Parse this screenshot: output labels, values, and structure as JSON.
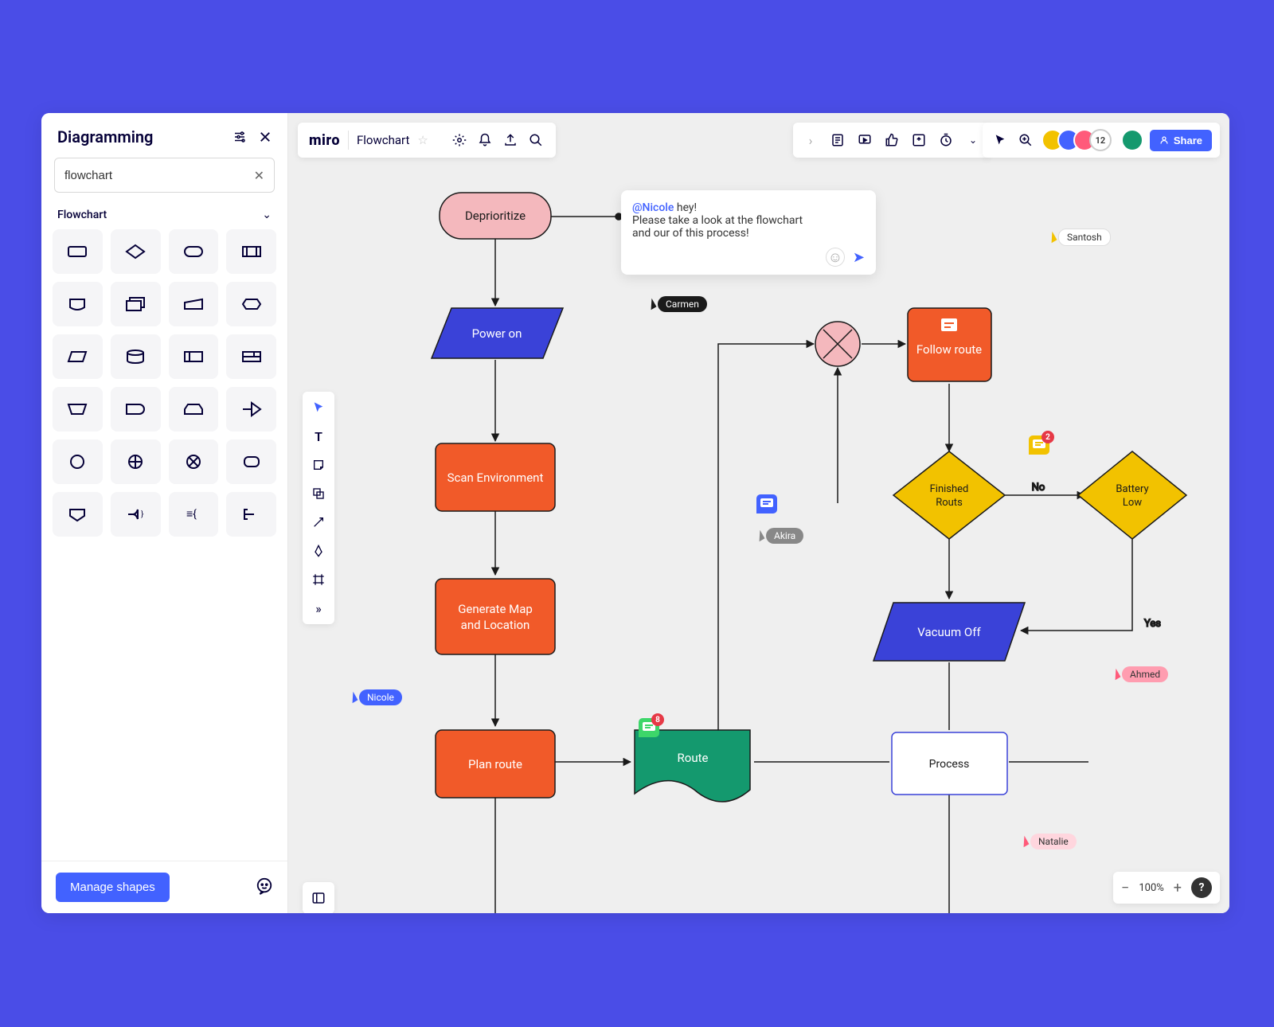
{
  "panel": {
    "title": "Diagramming",
    "search_value": "flowchart",
    "section_label": "Flowchart",
    "manage_label": "Manage shapes",
    "shapes": [
      "rectangle",
      "diamond",
      "rounded-rect",
      "predefined-process",
      "display",
      "multi-document",
      "manual-input",
      "preparation",
      "parallelogram",
      "database",
      "internal-storage",
      "card",
      "manual-operation",
      "delay",
      "loop-limit",
      "off-page",
      "circle",
      "summing-junction",
      "or-junction",
      "collate",
      "data-storage",
      "merge-right",
      "merge-left",
      "annotation"
    ]
  },
  "header": {
    "brand": "miro",
    "board_name": "Flowchart",
    "share_label": "Share",
    "avatar_count": "12"
  },
  "zoom": {
    "level": "100%"
  },
  "comment": {
    "mention": "@Nicole",
    "greeting": " hey!",
    "line2": "Please take a look at the flowchart",
    "line3": "and our of this process!"
  },
  "nodes": {
    "deprioritize": "Deprioritize",
    "power_on": "Power on",
    "scan_env": "Scan Environment",
    "gen_map1": "Generate Map",
    "gen_map2": "and Location",
    "plan_route": "Plan route",
    "route": "Route",
    "process": "Process",
    "follow_route": "Follow route",
    "finished1": "Finished",
    "finished2": "Routs",
    "battery1": "Battery",
    "battery2": "Low",
    "vacuum_off": "Vacuum Off"
  },
  "edges": {
    "no": "No",
    "yes": "Yes"
  },
  "cursors": {
    "nicole": "Nicole",
    "carmen": "Carmen",
    "akira": "Akira",
    "santosh": "Santosh",
    "ahmed": "Ahmed",
    "natalie": "Natalie"
  },
  "badges": {
    "green_count": "8",
    "yellow_count": "2"
  },
  "colors": {
    "orange": "#f15a29",
    "blue": "#3a42d8",
    "pink": "#f4b8bd",
    "green": "#14996e",
    "yellow": "#f2c200",
    "stroke": "#1a1a1a",
    "accent": "#4262ff"
  }
}
